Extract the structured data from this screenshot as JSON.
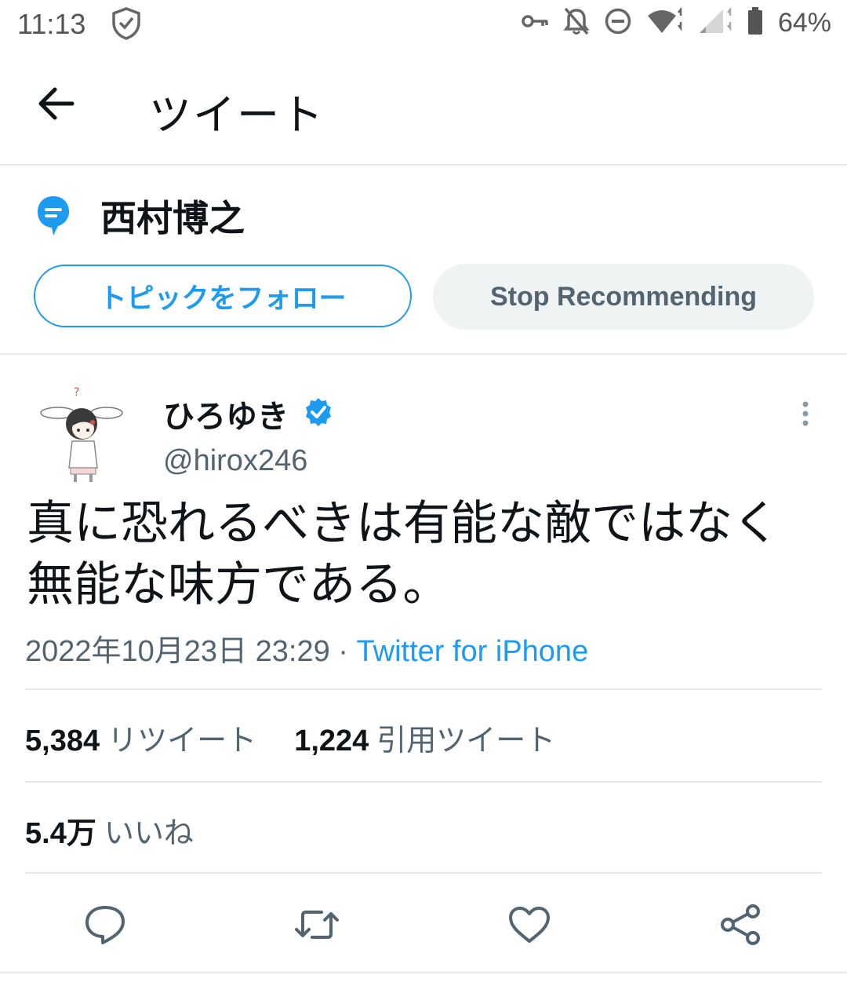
{
  "status_bar": {
    "time": "11:13",
    "battery_percent": "64%",
    "icons": [
      "shield-check-icon",
      "vpn-key-icon",
      "notifications-off-icon",
      "do-not-disturb-icon",
      "wifi-icon",
      "cellular-signal-icon",
      "battery-icon"
    ]
  },
  "header": {
    "title": "ツイート",
    "back_icon": "arrow-left-icon"
  },
  "topic": {
    "name": "西村博之",
    "follow_label": "トピックをフォロー",
    "stop_label": "Stop Recommending"
  },
  "tweet": {
    "display_name": "ひろゆき",
    "handle": "@hirox246",
    "verified": true,
    "text": "真に恐れるべきは有能な敵ではなく\n無能な味方である。",
    "timestamp": "2022年10月23日 23:29",
    "separator": " · ",
    "source": "Twitter for iPhone",
    "stats": {
      "retweets_count": "5,384",
      "retweets_label": "リツイート",
      "quotes_count": "1,224",
      "quotes_label": "引用ツイート",
      "likes_count": "5.4万",
      "likes_label": "いいね"
    }
  },
  "actions": [
    "reply-icon",
    "retweet-icon",
    "like-icon",
    "share-icon"
  ],
  "colors": {
    "accent": "#1d9bf0",
    "secondary_text": "#536471",
    "primary_text": "#0f1419",
    "divider": "#e6e9eb",
    "stop_button_bg": "#eff3f4"
  }
}
